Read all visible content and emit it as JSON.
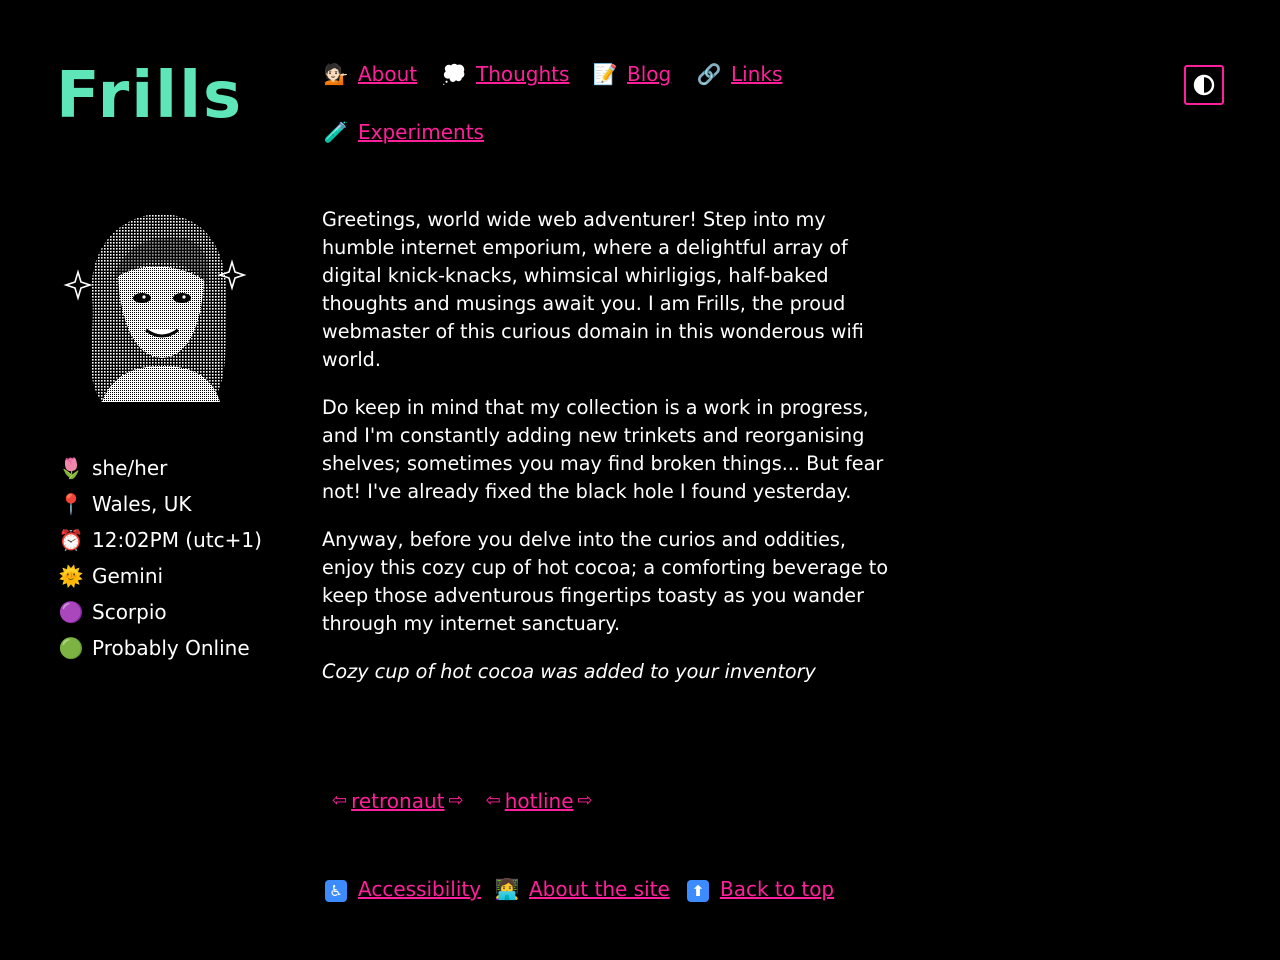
{
  "site": {
    "logo": "Frills"
  },
  "nav": {
    "items": [
      {
        "icon": "person-tipping-hand-icon",
        "emoji": "💁🏻",
        "label": "About"
      },
      {
        "icon": "thought-balloon-icon",
        "emoji": "💭",
        "label": "Thoughts"
      },
      {
        "icon": "memo-icon",
        "emoji": "📝",
        "label": "Blog"
      },
      {
        "icon": "link-icon",
        "emoji": "🔗",
        "label": "Links"
      },
      {
        "icon": "test-tube-icon",
        "emoji": "🧪",
        "label": "Experiments"
      }
    ]
  },
  "theme_toggle": {
    "icon": "contrast-half-circle-icon"
  },
  "profile": {
    "items": [
      {
        "icon": "tulip-icon",
        "emoji": "🌷",
        "text": "she/her"
      },
      {
        "icon": "round-pushpin-icon",
        "emoji": "📍",
        "text": "Wales, UK"
      },
      {
        "icon": "alarm-clock-icon",
        "emoji": "⏰",
        "text": "12:02PM (utc+1)"
      },
      {
        "icon": "sun-with-face-icon",
        "emoji": "🌞",
        "text": "Gemini"
      },
      {
        "icon": "purple-moon-face-icon",
        "emoji": "🟣",
        "text": "Scorpio"
      },
      {
        "icon": "green-circle-icon",
        "emoji": "🟢",
        "text": "Probably Online"
      }
    ]
  },
  "content": {
    "paragraphs": [
      "Greetings, world wide web adventurer! Step into my humble internet emporium, where a delightful array of digital knick-knacks, whimsical whirligigs, half-baked thoughts and musings await you. I am Frills, the proud webmaster of this curious domain in this wonderous wifi world.",
      "Do keep in mind that my collection is a work in progress, and I'm constantly adding new trinkets and reorganising shelves; sometimes you may find broken things... But fear not! I've already fixed the black hole I found yesterday.",
      "Anyway, before you delve into the curios and oddities, enjoy this cozy cup of hot cocoa; a comforting beverage to keep those adventurous fingertips toasty as you wander through my internet sanctuary."
    ],
    "inventory_note": "Cozy cup of hot cocoa was added to your inventory"
  },
  "webrings": [
    {
      "prev_arrow": "⇦",
      "label": "retronaut",
      "next_arrow": "⇨"
    },
    {
      "prev_arrow": "⇦",
      "label": "hotline",
      "next_arrow": "⇨"
    }
  ],
  "footer": {
    "items": [
      {
        "icon": "wheelchair-icon",
        "emoji": "♿",
        "label": "Accessibility"
      },
      {
        "icon": "technologist-icon",
        "emoji": "👩‍💻",
        "label": "About the site"
      },
      {
        "icon": "up-arrow-icon",
        "emoji": "⬆",
        "label": "Back to top"
      }
    ]
  },
  "colors": {
    "background": "#000000",
    "text": "#ffffff",
    "link": "#ff1f9a",
    "logo": "#5ee6b8"
  }
}
